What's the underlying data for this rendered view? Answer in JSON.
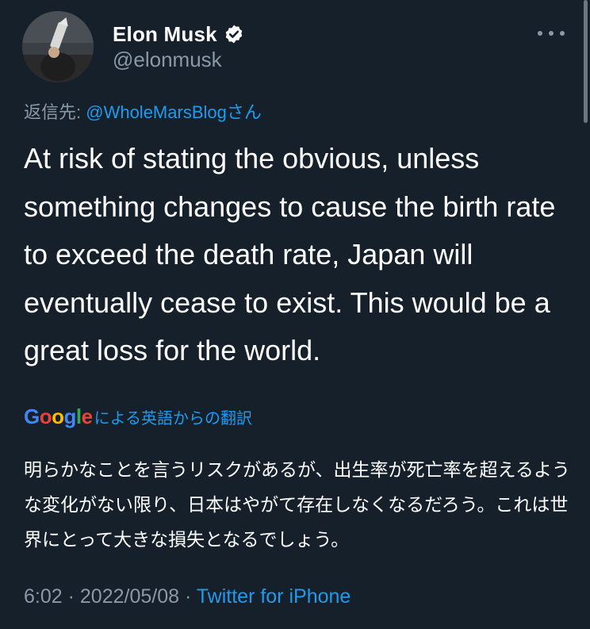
{
  "author": {
    "display_name": "Elon Musk",
    "handle": "@elonmusk",
    "verified": true
  },
  "reply": {
    "prefix": "返信先: ",
    "mention": "@WholeMarsBlogさん"
  },
  "tweet": {
    "text": "At risk of stating the obvious, unless something changes to cause the birth rate to exceed the death rate, Japan will eventually cease to exist. This would be a great loss for the world."
  },
  "translation": {
    "provider_logo": "Google",
    "label": "による英語からの翻訳",
    "text": "明らかなことを言うリスクがあるが、出生率が死亡率を超えるような変化がない限り、日本はやがて存在しなくなるだろう。これは世界にとって大きな損失となるでしょう。"
  },
  "meta": {
    "time": "6:02",
    "sep1": " · ",
    "date": "2022/05/08",
    "sep2": " · ",
    "source": "Twitter for iPhone"
  },
  "icons": {
    "verified": "verified-badge-icon",
    "more": "more-options-icon"
  },
  "colors": {
    "background": "#15202b",
    "primary_text": "#ffffff",
    "secondary_text": "#8b98a5",
    "accent": "#1d9bf0"
  }
}
